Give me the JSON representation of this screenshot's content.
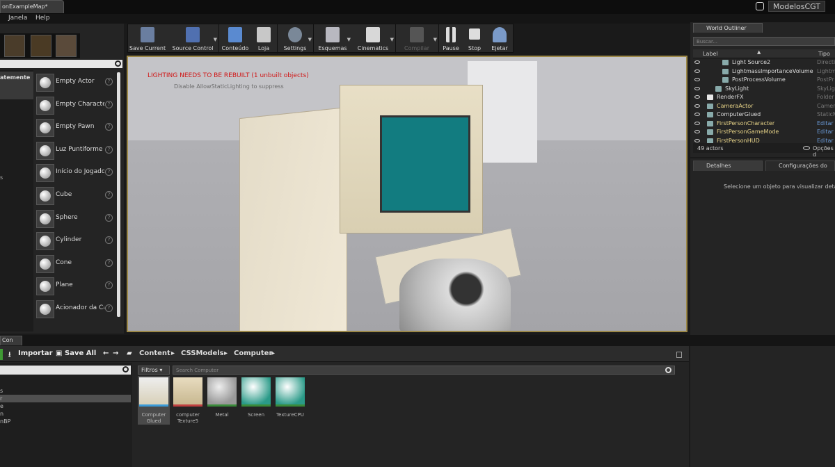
{
  "window": {
    "doc_tab": "onExampleMap*",
    "project_name": "ModelosCGT"
  },
  "menu": [
    "Janela",
    "Help"
  ],
  "modes": {
    "search_placeholder": "",
    "selected_category": "atemente",
    "categories_fragment": "s",
    "items": [
      {
        "label": "Empty Actor",
        "icon": "sphere-icon"
      },
      {
        "label": "Empty Character",
        "icon": "character-icon"
      },
      {
        "label": "Empty Pawn",
        "icon": "pawn-icon"
      },
      {
        "label": "Luz Puntiforme",
        "icon": "point-light-icon"
      },
      {
        "label": "Início do Jogador",
        "icon": "player-start-icon"
      },
      {
        "label": "Cube",
        "icon": "cube-icon"
      },
      {
        "label": "Sphere",
        "icon": "sphere-icon"
      },
      {
        "label": "Cylinder",
        "icon": "cylinder-icon"
      },
      {
        "label": "Cone",
        "icon": "cone-icon"
      },
      {
        "label": "Plane",
        "icon": "plane-icon"
      },
      {
        "label": "Acionador da Cai",
        "icon": "trigger-box-icon"
      }
    ]
  },
  "toolbar": {
    "buttons": [
      {
        "label": "Save Current",
        "icon": "save-icon"
      },
      {
        "label": "Source Control",
        "icon": "source-control-icon"
      },
      {
        "label": "Conteúdo",
        "icon": "content-icon"
      },
      {
        "label": "Loja",
        "icon": "marketplace-icon"
      },
      {
        "label": "Settings",
        "icon": "settings-icon"
      },
      {
        "label": "Esquemas",
        "icon": "blueprints-icon"
      },
      {
        "label": "Cinematics",
        "icon": "cinematics-icon"
      },
      {
        "label": "Compilar",
        "icon": "build-icon"
      },
      {
        "label": "Pause",
        "icon": "pause-icon"
      },
      {
        "label": "Stop",
        "icon": "stop-icon"
      },
      {
        "label": "Ejetar",
        "icon": "eject-icon"
      }
    ]
  },
  "viewport": {
    "warning": "LIGHTING NEEDS TO BE REBUILT (1 unbuilt objects)",
    "warning_sub": "Disable AllowStaticLighting to suppress"
  },
  "outliner": {
    "tab": "World Outliner",
    "search_placeholder": "Buscar...",
    "col_label": "Label",
    "col_type": "Tipo",
    "rows": [
      {
        "name": "Light Source2",
        "type": "Directio"
      },
      {
        "name": "LightmassImportanceVolume",
        "type": "Lightm"
      },
      {
        "name": "PostProcessVolume",
        "type": "PostPr"
      },
      {
        "name": "SkyLight",
        "type": "SkyLigt"
      },
      {
        "name": "RenderFX",
        "type": "Folder"
      },
      {
        "name": "CameraActor",
        "type": "Camera"
      },
      {
        "name": "ComputerGlued",
        "type": "StaticM"
      },
      {
        "name": "FirstPersonCharacter",
        "type": "Editar"
      },
      {
        "name": "FirstPersonGameMode",
        "type": "Editar"
      },
      {
        "name": "FirstPersonHUD",
        "type": "Editar"
      }
    ],
    "count": "49 actors",
    "view_options": "Opções d"
  },
  "details": {
    "tab1": "Detalhes",
    "tab2": "Configurações do",
    "message": "Selecione um objeto para visualizar detalhe"
  },
  "content_browser": {
    "tab": "Con",
    "import_label": "Importar",
    "save_all_label": "Save All",
    "breadcrumb": [
      "Content",
      "CSSModels",
      "Computer"
    ],
    "filters_label": "Filtros",
    "search_placeholder": "Search Computer",
    "left_items": [
      "s",
      "r",
      "e",
      "n",
      "nBP"
    ],
    "assets": [
      {
        "name": "Computer Glued",
        "kind": "mesh"
      },
      {
        "name": "computer Texture5",
        "kind": "texture"
      },
      {
        "name": "Metal",
        "kind": "material"
      },
      {
        "name": "Screen",
        "kind": "material"
      },
      {
        "name": "TextureCPU",
        "kind": "material"
      }
    ]
  }
}
